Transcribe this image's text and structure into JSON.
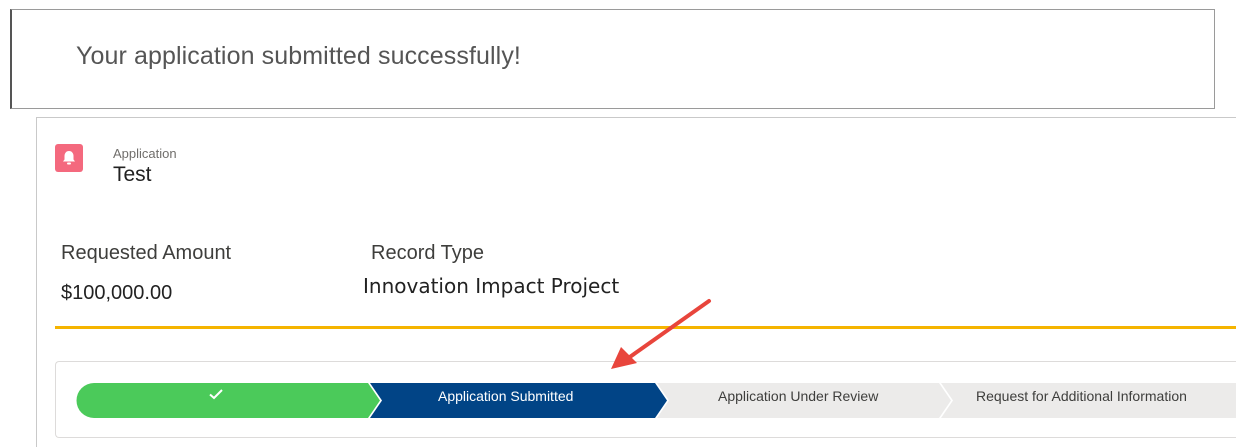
{
  "toast": {
    "message": "Your application submitted successfully!"
  },
  "record": {
    "object_label": "Application",
    "name": "Test",
    "icon": "bell-icon"
  },
  "fields": [
    {
      "label": "Requested Amount",
      "value": "$100,000.00"
    },
    {
      "label": "Record Type",
      "value": "Innovation Impact Project"
    }
  ],
  "path": {
    "stages": [
      {
        "label": "",
        "status": "complete",
        "icon": "check-icon"
      },
      {
        "label": "Application Submitted",
        "status": "current"
      },
      {
        "label": "Application Under Review",
        "status": "incomplete"
      },
      {
        "label": "Request for Additional Information",
        "status": "incomplete"
      }
    ]
  },
  "colors": {
    "complete": "#4bca5a",
    "current": "#014486",
    "incomplete": "#ecebea",
    "highlight_line": "#f5b400",
    "annotation_arrow": "#e8453c",
    "object_icon": "#f4697e"
  }
}
